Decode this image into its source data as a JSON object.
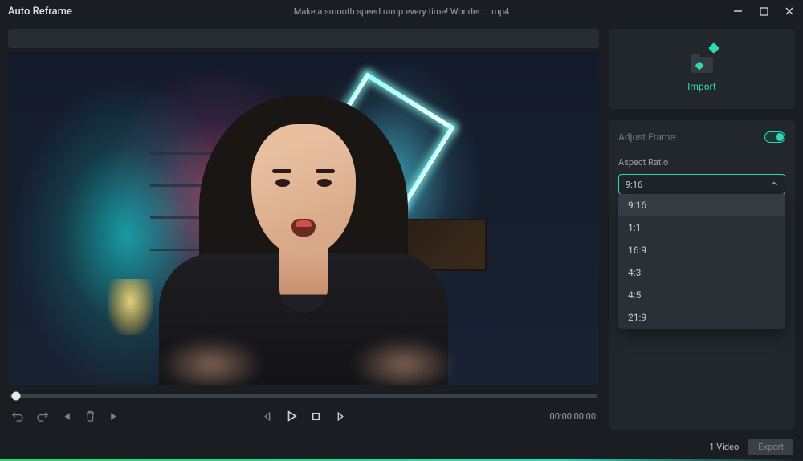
{
  "titlebar": {
    "app_title": "Auto Reframe",
    "filename": "Make a smooth speed ramp every time!  Wonder... .mp4"
  },
  "playback": {
    "timecode": "00:00:00:00"
  },
  "import": {
    "label": "Import"
  },
  "adjust": {
    "title": "Adjust Frame",
    "aspect_ratio_label": "Aspect Ratio",
    "selected_value": "9:16",
    "options": [
      "9:16",
      "1:1",
      "16:9",
      "4:3",
      "4:5",
      "21:9"
    ]
  },
  "footer": {
    "video_count": "1 Video",
    "export_label": "Export"
  },
  "colors": {
    "accent": "#2fd9b4",
    "bg": "#1a1d21",
    "panel": "#22272c"
  }
}
